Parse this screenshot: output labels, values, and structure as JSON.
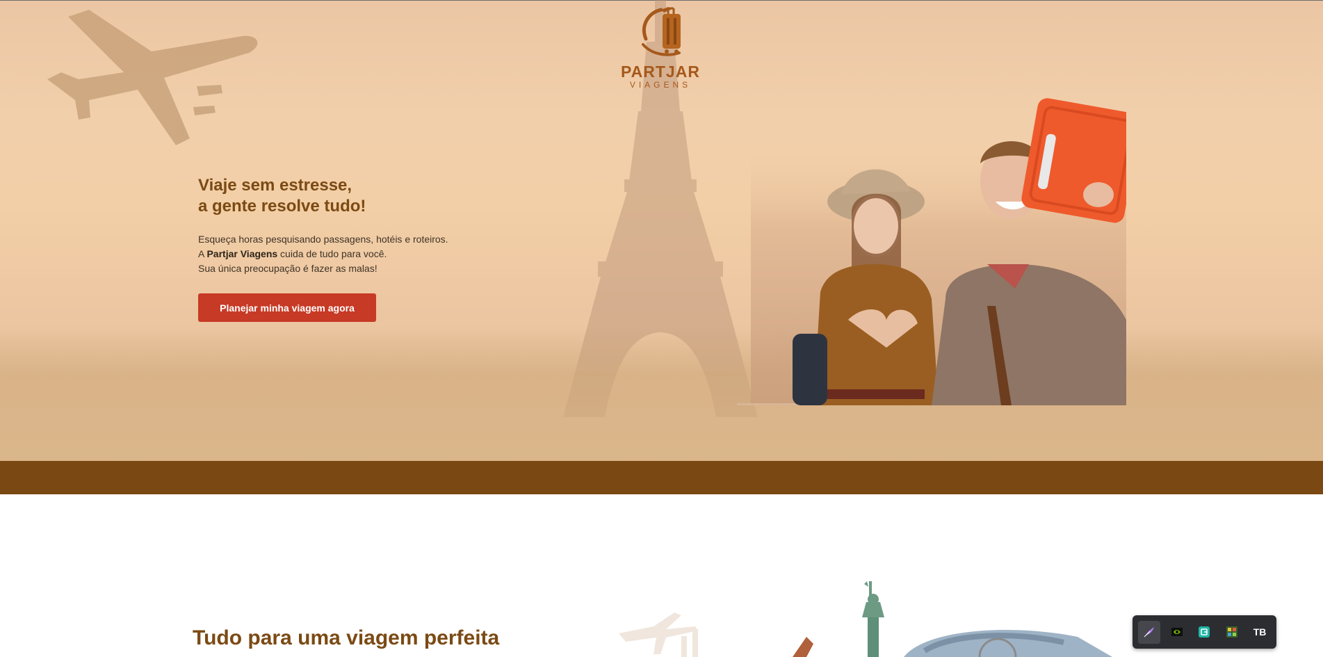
{
  "brand": {
    "name": "PARTJAR",
    "subtitle": "VIAGENS"
  },
  "hero": {
    "headline_line1": "Viaje sem estresse,",
    "headline_line2": "a gente resolve tudo!",
    "body_line1": "Esqueça horas pesquisando passagens, hotéis e roteiros.",
    "body_line2_prefix": "A ",
    "body_line2_bold": "Partjar Viagens",
    "body_line2_suffix": " cuida de tudo para você.",
    "body_line3": "Sua única preocupação é fazer as malas!",
    "cta_label": "Planejar minha viagem agora"
  },
  "section2": {
    "title": "Tudo para uma viagem perfeita"
  },
  "extension_toolbar": {
    "items": [
      {
        "icon": "feather-icon",
        "active": true
      },
      {
        "icon": "nvidia-icon",
        "active": false
      },
      {
        "icon": "clipboard-icon",
        "active": false
      },
      {
        "icon": "grid-icon",
        "active": false
      },
      {
        "icon": "tb-icon",
        "label": "TB",
        "active": false
      }
    ]
  },
  "colors": {
    "brand_brown": "#7b4a14",
    "band_brown": "#7a4813",
    "cta_red": "#c73a26",
    "hero_peach": "#f1cfab"
  }
}
